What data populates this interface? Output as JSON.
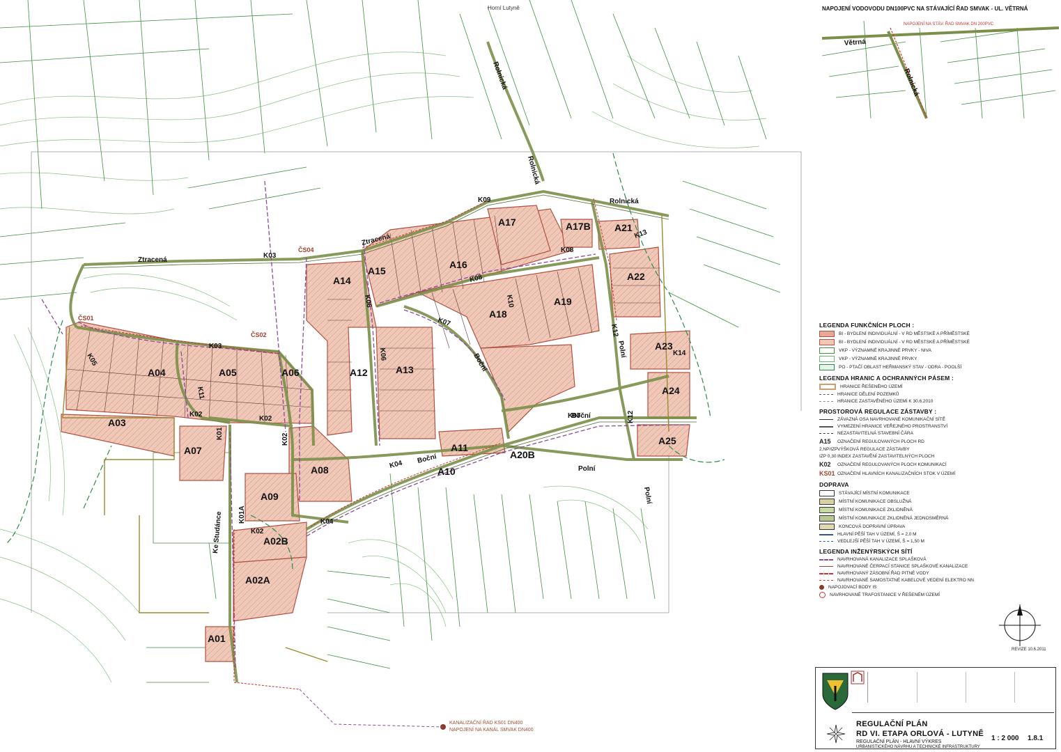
{
  "inset": {
    "title": "NAPOJENÍ VODOVODU DN100PVC NA STÁVAJÍCÍ ŘAD SMVAK - UL. VĚTRNÁ",
    "street1": "Větrná",
    "street2": "Rolnická",
    "note": "NAPOJENÍ NA STÁV. ŘAD SMVAK DN 200PVC"
  },
  "plots": [
    "A01",
    "A02A",
    "A02B",
    "A03",
    "A04",
    "A05",
    "A06",
    "A07",
    "A08",
    "A09",
    "A10",
    "A11",
    "A12",
    "A13",
    "A14",
    "A15",
    "A16",
    "A17",
    "A17B",
    "A18",
    "A19",
    "A20B",
    "A21",
    "A22",
    "A23",
    "A24",
    "A25"
  ],
  "roads": [
    "K01",
    "K01A",
    "K02",
    "K03",
    "K04",
    "K05",
    "K06",
    "K07",
    "K08",
    "K09",
    "K10",
    "K11",
    "K12",
    "K13",
    "K14"
  ],
  "streets": {
    "ztracena": "Ztracená",
    "rolnicka": "Rolnická",
    "polni": "Polní",
    "bocni": "Boční",
    "ke_studance": "Ke Studánce",
    "horni_lutyne": "Horní Lutyně"
  },
  "sewers": [
    "ČS01",
    "ČS02",
    "ČS04"
  ],
  "legend": {
    "funkcni_title": "LEGENDA FUNKČNÍCH PLOCH :",
    "funkcni_rows": [
      "BI - BYDLENÍ INDIVIDUÁLNÍ - V RD MĚSTSKÉ A PŘÍMĚSTSKÉ",
      "BI - BYDLENÍ INDIVIDUÁLNÍ - V RD MĚSTSKÉ A PŘÍMĚSTSKÉ",
      "VKP - VÝZNAMNÉ KRAJINNÉ PRVKY - NIVA",
      "VKP - VÝZNAMNÉ KRAJINNÉ PRVKY",
      "PO - PTAČÍ OBLAST HEŘMANSKÝ STAV - ODRA - POOLŠÍ"
    ],
    "hranice_title": "LEGENDA HRANIC A OCHRANNÝCH PÁSEM :",
    "hranice_rows": [
      "HRANICE ŘEŠENÉHO ÚZEMÍ",
      "HRANICE DĚLENÍ POZEMKŮ",
      "HRANICE ZASTAVĚNÉHO ÚZEMÍ K 30.6.2010"
    ],
    "prostorova_title": "PROSTOROVÁ REGULACE ZÁSTAVBY :",
    "prostorova_rows": [
      "ZÁVAZNÁ OSA NAVRHOVANÉ KOMUNIKAČNÍ SÍTĚ",
      "VYMEZENÍ HRANICE VEŘEJNÉHO PROSTRANSTVÍ",
      "NEZASTAVITELNÁ STAVEBNÍ ČÁRA",
      "OZNAČENÍ REGULOVANÝCH PLOCH RD",
      "VÝŠKOVÁ REGULACE ZÁSTAVBY",
      "INDEX ZASTAVĚNÍ ZASTAVITELNÝCH PLOCH",
      "OZNAČENÍ REGULOVANÝCH PLOCH KOMUNIKACÍ",
      "OZNAČENÍ HLAVNÍCH KANALIZAČNÍCH STOK V ÚZEMÍ"
    ],
    "prostorova_samples": [
      "A15",
      "2,NP/IZP",
      "IZP 0,30",
      "K02",
      "KS01"
    ],
    "doprava_title": "DOPRAVA",
    "doprava_rows": [
      "STÁVAJÍCÍ MÍSTNÍ KOMUNIKACE",
      "MÍSTNÍ KOMUNIKACE OBSLUŽNÁ",
      "MÍSTNÍ KOMUNIKACE ZKLIDNĚNÁ",
      "MÍSTNÍ KOMUNIKACE ZKLIDNĚNÁ JEDNOSMĚRNÁ",
      "KONCOVÁ DOPRAVNÍ ÚPRAVA",
      "HLAVNÍ PĚŠÍ TAH V ÚZEMÍ, Š = 2,0 M",
      "VEDLEJŠÍ PĚŠÍ TAH V ÚZEMÍ, Š = 1,50 M"
    ],
    "site_title": "LEGENDA INŽENÝRSKÝCH SÍTÍ",
    "site_rows": [
      "NAVRHOVANÁ KANALIZACE SPLAŠKOVÁ",
      "NAVRHOVANÉ ČERPACÍ STANICE SPLAŠKOVÉ KANALIZACE",
      "NAVRHOVANÝ ZÁSOBNÍ ŘAD PITNÉ VODY",
      "NAVRHOVANÉ SAMOSTATNÉ KABELOVÉ VEDENÍ ELEKTRO NN",
      "NAPOJOVACÍ BODY IS",
      "NAVRHOVANÉ TRAFOSTANICE V ŘEŠENÉM ÚZEMÍ"
    ]
  },
  "titleblock": {
    "title": "REGULAČNÍ PLÁN",
    "subtitle": "RD VI. ETAPA ORLOVÁ - LUTYNĚ",
    "drawing": "REGULAČNÍ PLÁN - HLAVNÍ VÝKRES",
    "drawing2": "URBANISTICKÉHO NÁVRHU A TECHNICKÉ INFRASTRUKTURY",
    "scale": "1 : 2 000",
    "number": "1.8.1",
    "revision": "REVIZE 10.6.2011"
  },
  "annotations": {
    "kanal": "KANALIZAČNÍ ŘAD KS01 DN400",
    "kanal2": "NAPOJENÍ NA KANÁL SMVAK DN400"
  },
  "colors": {
    "plot_fill": "#f0c8b8",
    "plot_stroke": "#b05040",
    "road": "#7b8f4a",
    "contour": "#5da35d",
    "parcel": "#3f8f3f",
    "sewer": "#8a4b9a",
    "water": "#d03030"
  }
}
